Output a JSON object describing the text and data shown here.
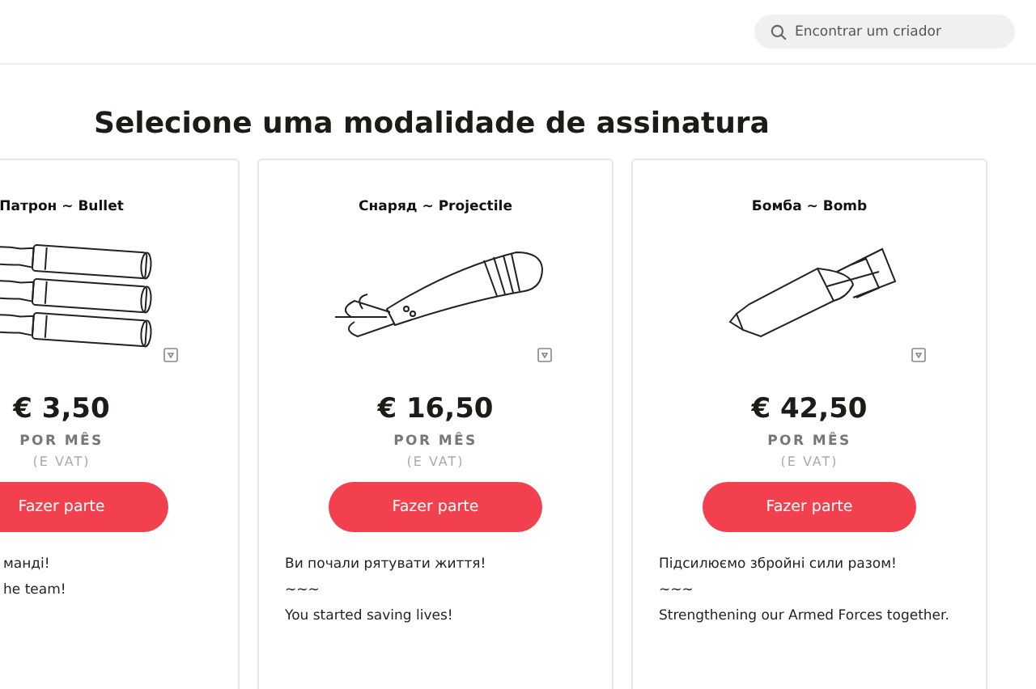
{
  "header": {
    "search": {
      "placeholder": "Encontrar um criador"
    }
  },
  "heading": "Selecione uma modalidade de assinatura",
  "plans": [
    {
      "kind": "bullets",
      "title": "Патрон ~ Bullet",
      "price": "€ 3,50",
      "period": "POR MÊS",
      "vat": "(E VAT)",
      "button": "Fazer parte",
      "description": [
        "манді!",
        "he team!"
      ]
    },
    {
      "kind": "shell",
      "title": "Снаряд ~ Projectile",
      "price": "€ 16,50",
      "period": "POR MÊS",
      "vat": "(E VAT)",
      "button": "Fazer parte",
      "description": [
        "Ви почали рятувати життя!",
        "~~~",
        "You started saving lives!"
      ]
    },
    {
      "kind": "bomb",
      "title": "Бомба ~ Bomb",
      "price": "€ 42,50",
      "period": "POR MÊS",
      "vat": "(E VAT)",
      "button": "Fazer parte",
      "description": [
        "Підсилюємо збройні сили разом!",
        "~~~",
        "Strengthening our Armed Forces together."
      ]
    }
  ]
}
